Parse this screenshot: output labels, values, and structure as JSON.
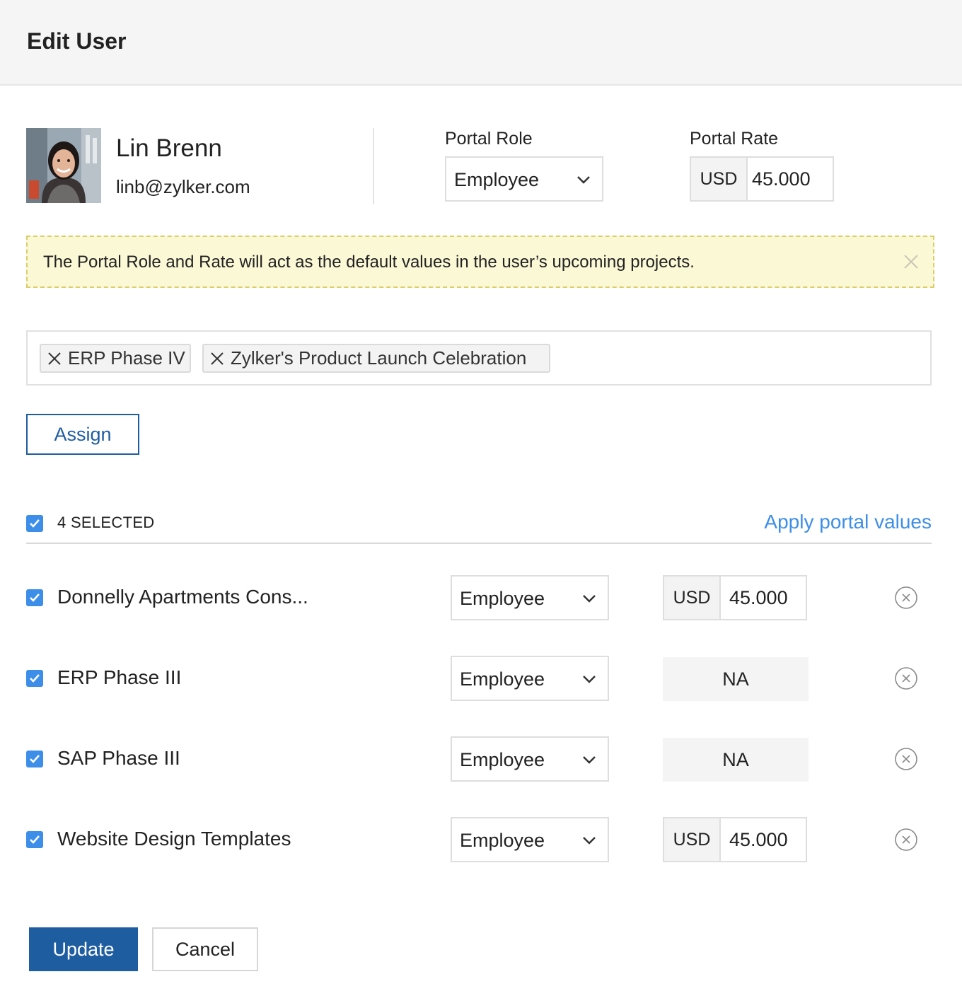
{
  "header": {
    "title": "Edit User"
  },
  "user": {
    "name": "Lin Brenn",
    "email": "linb@zylker.com"
  },
  "portal": {
    "role_label": "Portal Role",
    "role_value": "Employee",
    "rate_label": "Portal Rate",
    "rate_currency": "USD",
    "rate_amount": "45.000"
  },
  "notice": {
    "message": "The Portal Role and Rate will act as the default values in the user’s upcoming projects."
  },
  "tags": [
    {
      "label": "ERP Phase IV"
    },
    {
      "label": "Zylker's Product Launch Celebration"
    }
  ],
  "assign_button": "Assign",
  "selection": {
    "count_label": "4 SELECTED",
    "apply_link": "Apply portal values",
    "checked": true
  },
  "projects": [
    {
      "name": "Donnelly Apartments Cons...",
      "role": "Employee",
      "currency": "USD",
      "rate": "45.000",
      "checked": true
    },
    {
      "name": "ERP Phase III",
      "role": "Employee",
      "rate_na": "NA",
      "checked": true
    },
    {
      "name": "SAP Phase III",
      "role": "Employee",
      "rate_na": "NA",
      "checked": true
    },
    {
      "name": "Website Design Templates",
      "role": "Employee",
      "currency": "USD",
      "rate": "45.000",
      "checked": true
    }
  ],
  "footer": {
    "update_label": "Update",
    "cancel_label": "Cancel"
  },
  "colors": {
    "primary": "#1f5da1",
    "accent": "#3d8ee8",
    "notice_bg": "#fbf8d6"
  }
}
